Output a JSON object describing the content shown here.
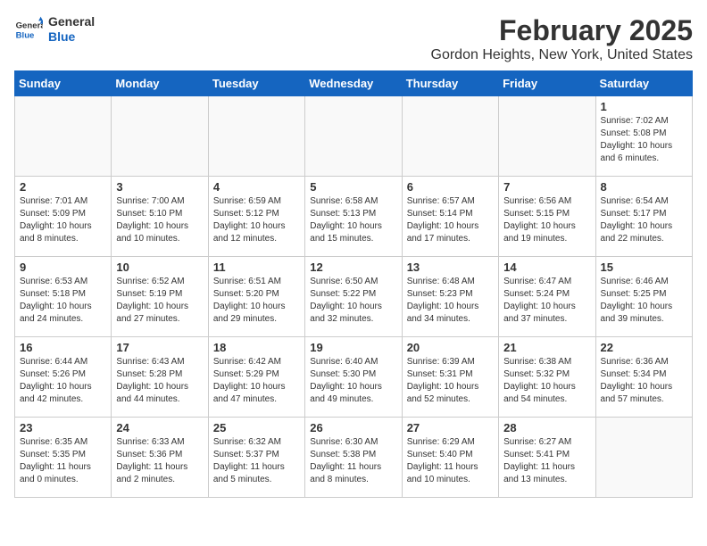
{
  "header": {
    "logo_general": "General",
    "logo_blue": "Blue",
    "title": "February 2025",
    "subtitle": "Gordon Heights, New York, United States"
  },
  "weekdays": [
    "Sunday",
    "Monday",
    "Tuesday",
    "Wednesday",
    "Thursday",
    "Friday",
    "Saturday"
  ],
  "weeks": [
    [
      {
        "day": "",
        "info": ""
      },
      {
        "day": "",
        "info": ""
      },
      {
        "day": "",
        "info": ""
      },
      {
        "day": "",
        "info": ""
      },
      {
        "day": "",
        "info": ""
      },
      {
        "day": "",
        "info": ""
      },
      {
        "day": "1",
        "info": "Sunrise: 7:02 AM\nSunset: 5:08 PM\nDaylight: 10 hours\nand 6 minutes."
      }
    ],
    [
      {
        "day": "2",
        "info": "Sunrise: 7:01 AM\nSunset: 5:09 PM\nDaylight: 10 hours\nand 8 minutes."
      },
      {
        "day": "3",
        "info": "Sunrise: 7:00 AM\nSunset: 5:10 PM\nDaylight: 10 hours\nand 10 minutes."
      },
      {
        "day": "4",
        "info": "Sunrise: 6:59 AM\nSunset: 5:12 PM\nDaylight: 10 hours\nand 12 minutes."
      },
      {
        "day": "5",
        "info": "Sunrise: 6:58 AM\nSunset: 5:13 PM\nDaylight: 10 hours\nand 15 minutes."
      },
      {
        "day": "6",
        "info": "Sunrise: 6:57 AM\nSunset: 5:14 PM\nDaylight: 10 hours\nand 17 minutes."
      },
      {
        "day": "7",
        "info": "Sunrise: 6:56 AM\nSunset: 5:15 PM\nDaylight: 10 hours\nand 19 minutes."
      },
      {
        "day": "8",
        "info": "Sunrise: 6:54 AM\nSunset: 5:17 PM\nDaylight: 10 hours\nand 22 minutes."
      }
    ],
    [
      {
        "day": "9",
        "info": "Sunrise: 6:53 AM\nSunset: 5:18 PM\nDaylight: 10 hours\nand 24 minutes."
      },
      {
        "day": "10",
        "info": "Sunrise: 6:52 AM\nSunset: 5:19 PM\nDaylight: 10 hours\nand 27 minutes."
      },
      {
        "day": "11",
        "info": "Sunrise: 6:51 AM\nSunset: 5:20 PM\nDaylight: 10 hours\nand 29 minutes."
      },
      {
        "day": "12",
        "info": "Sunrise: 6:50 AM\nSunset: 5:22 PM\nDaylight: 10 hours\nand 32 minutes."
      },
      {
        "day": "13",
        "info": "Sunrise: 6:48 AM\nSunset: 5:23 PM\nDaylight: 10 hours\nand 34 minutes."
      },
      {
        "day": "14",
        "info": "Sunrise: 6:47 AM\nSunset: 5:24 PM\nDaylight: 10 hours\nand 37 minutes."
      },
      {
        "day": "15",
        "info": "Sunrise: 6:46 AM\nSunset: 5:25 PM\nDaylight: 10 hours\nand 39 minutes."
      }
    ],
    [
      {
        "day": "16",
        "info": "Sunrise: 6:44 AM\nSunset: 5:26 PM\nDaylight: 10 hours\nand 42 minutes."
      },
      {
        "day": "17",
        "info": "Sunrise: 6:43 AM\nSunset: 5:28 PM\nDaylight: 10 hours\nand 44 minutes."
      },
      {
        "day": "18",
        "info": "Sunrise: 6:42 AM\nSunset: 5:29 PM\nDaylight: 10 hours\nand 47 minutes."
      },
      {
        "day": "19",
        "info": "Sunrise: 6:40 AM\nSunset: 5:30 PM\nDaylight: 10 hours\nand 49 minutes."
      },
      {
        "day": "20",
        "info": "Sunrise: 6:39 AM\nSunset: 5:31 PM\nDaylight: 10 hours\nand 52 minutes."
      },
      {
        "day": "21",
        "info": "Sunrise: 6:38 AM\nSunset: 5:32 PM\nDaylight: 10 hours\nand 54 minutes."
      },
      {
        "day": "22",
        "info": "Sunrise: 6:36 AM\nSunset: 5:34 PM\nDaylight: 10 hours\nand 57 minutes."
      }
    ],
    [
      {
        "day": "23",
        "info": "Sunrise: 6:35 AM\nSunset: 5:35 PM\nDaylight: 11 hours\nand 0 minutes."
      },
      {
        "day": "24",
        "info": "Sunrise: 6:33 AM\nSunset: 5:36 PM\nDaylight: 11 hours\nand 2 minutes."
      },
      {
        "day": "25",
        "info": "Sunrise: 6:32 AM\nSunset: 5:37 PM\nDaylight: 11 hours\nand 5 minutes."
      },
      {
        "day": "26",
        "info": "Sunrise: 6:30 AM\nSunset: 5:38 PM\nDaylight: 11 hours\nand 8 minutes."
      },
      {
        "day": "27",
        "info": "Sunrise: 6:29 AM\nSunset: 5:40 PM\nDaylight: 11 hours\nand 10 minutes."
      },
      {
        "day": "28",
        "info": "Sunrise: 6:27 AM\nSunset: 5:41 PM\nDaylight: 11 hours\nand 13 minutes."
      },
      {
        "day": "",
        "info": ""
      }
    ]
  ]
}
